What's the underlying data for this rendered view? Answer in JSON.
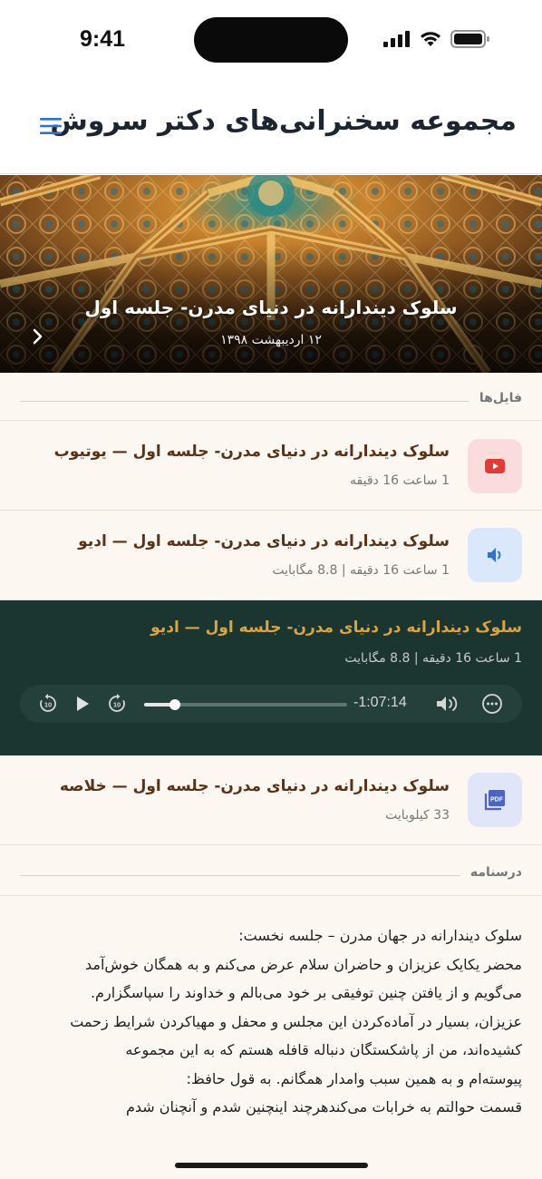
{
  "status_bar": {
    "time": "9:41",
    "icons": [
      "cellular-signal-icon",
      "wifi-icon",
      "battery-icon"
    ]
  },
  "header": {
    "title": "مجموعه سخنرانی‌های دکتر سروش",
    "menu_icon": "hamburger-menu-icon"
  },
  "hero": {
    "title": "سلوک دیندارانه در دنیای مدرن- جلسه اول",
    "date": "۱۲ اردیبهشت ۱۳۹۸",
    "next_icon": "chevron-right-icon"
  },
  "files_section": {
    "label": "فایل‌ها",
    "items": [
      {
        "title": "سلوک دیندارانه در دنیای مدرن- جلسه اول — یوتیوب",
        "meta": "1 ساعت 16 دقیقه",
        "icon": "youtube-icon",
        "icon_color": "#e53935",
        "icon_bg": "#fbdcdc"
      },
      {
        "title": "سلوک دیندارانه در دنیای مدرن- جلسه اول — ادیو",
        "meta": "1 ساعت 16 دقیقه | 8.8 مگابایت",
        "icon": "speaker-icon",
        "icon_color": "#2f6fd6",
        "icon_bg": "#dbe8fb"
      },
      {
        "title": "سلوک دیندارانه در دنیای مدرن- جلسه اول — خلاصه",
        "meta": "33 کیلوبایت",
        "icon": "pdf-icon",
        "icon_color": "#4a63c8",
        "icon_bg": "#e1e5f8"
      }
    ]
  },
  "player": {
    "title": "سلوک دیندارانه در دنیای مدرن- جلسه اول — ادیو",
    "meta": "1 ساعت 16 دقیقه | 8.8 مگابایت",
    "time_remaining": "-1:07:14",
    "progress": 0.15,
    "controls": [
      "rewind-10-icon",
      "play-icon",
      "forward-10-icon",
      "volume-icon",
      "more-options-icon"
    ]
  },
  "transcript_section": {
    "label": "درسنامه",
    "lines": [
      "سلوک دیندارانه در جهان مدرن – جلسه نخست:",
      "محضر یکایک عزیزان و حاضران سلام عرض می‌کنم و به همگان خوش‌آمد",
      "می‌گویم و از یافتن چنین توفیقی بر خود می‌بالم و خداوند را سپاسگزارم.",
      "عزیزان، بسیار در آماده‌کردن این مجلس و محفل و مهیاکردن شرایط زحمت",
      "کشیده‌اند، من از پاشکستگان دنباله قافله هستم که به این مجموعه",
      "پیوسته‌ام و به همین سبب وامدار همگانم. به قول حافظ:",
      "قسمت حوالتم به خرابات می‌کندهرچند اینچنین شدم و آنچنان شدم"
    ]
  }
}
